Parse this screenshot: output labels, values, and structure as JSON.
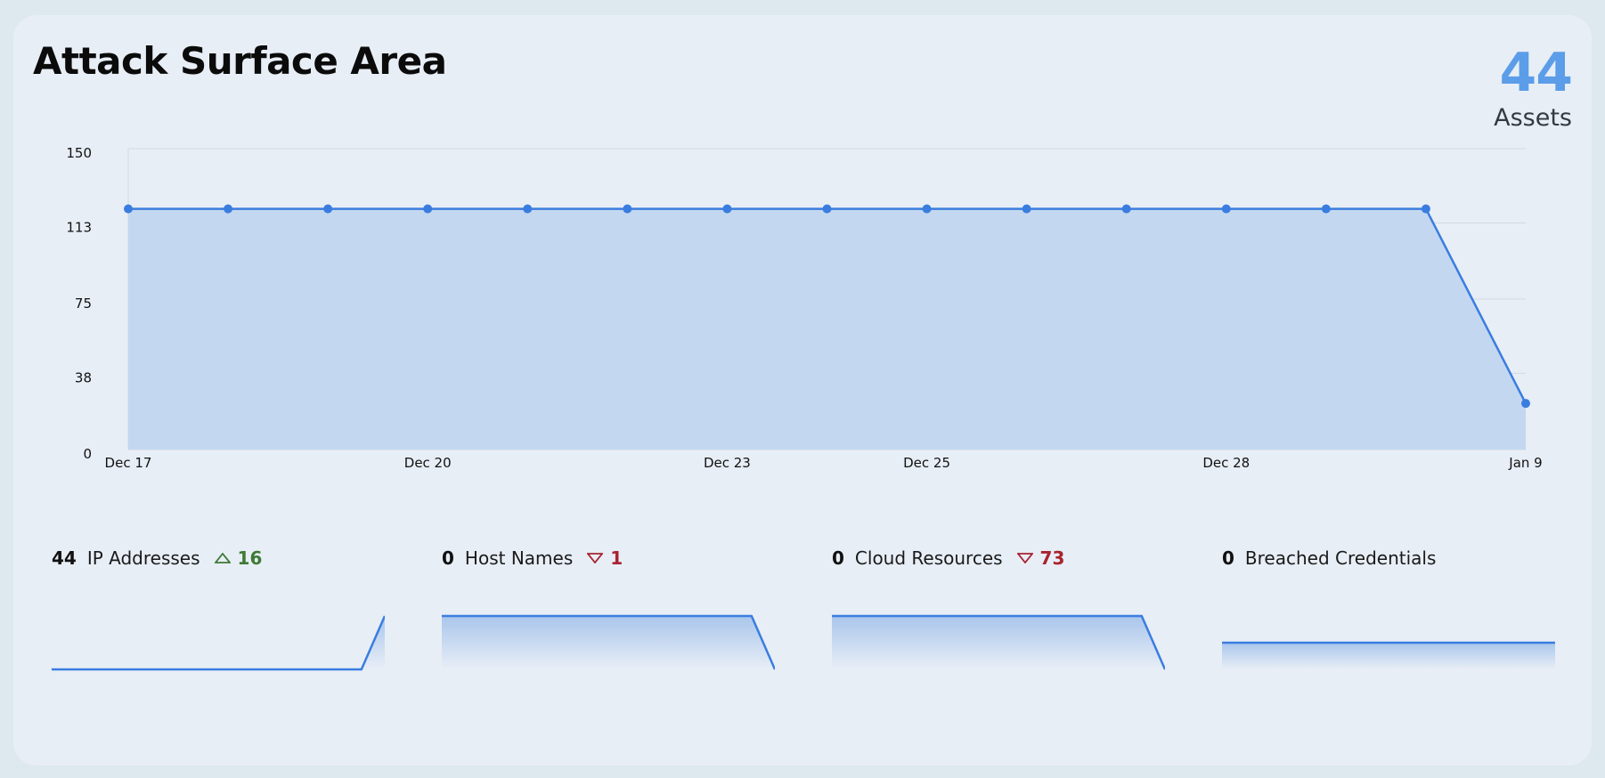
{
  "header": {
    "title": "Attack Surface Area",
    "total_value": "44",
    "total_label": "Assets"
  },
  "colors": {
    "accent": "#3a7de0",
    "fill": "#c3d7f0",
    "total": "#5b9de8",
    "up": "#3d7a35",
    "down": "#a8232f"
  },
  "chart_data": {
    "type": "area",
    "x": [
      "Dec 17",
      "Dec 18",
      "Dec 19",
      "Dec 20",
      "Dec 21",
      "Dec 22",
      "Dec 23",
      "Dec 24",
      "Dec 25",
      "Dec 26",
      "Dec 27",
      "Dec 28",
      "Dec 29",
      "Dec 30",
      "Jan 9"
    ],
    "values": [
      120,
      120,
      120,
      120,
      120,
      120,
      120,
      120,
      120,
      120,
      120,
      120,
      120,
      120,
      23
    ],
    "xticks": [
      "Dec 17",
      "Dec 20",
      "Dec 23",
      "Dec 25",
      "Dec 28",
      "Jan 9"
    ],
    "yticks": [
      "150",
      "113",
      "75",
      "38",
      "0"
    ],
    "ylim": [
      0,
      150
    ],
    "grid": true,
    "markers": true
  },
  "stats": [
    {
      "count": "44",
      "label": "IP Addresses",
      "trend": "up",
      "delta": "16",
      "spark": [
        0,
        0,
        0,
        0,
        0,
        0,
        0,
        0,
        0,
        0,
        0,
        0,
        1
      ]
    },
    {
      "count": "0",
      "label": "Host Names",
      "trend": "down",
      "delta": "1",
      "spark": [
        1,
        1,
        1,
        1,
        1,
        1,
        1,
        1,
        1,
        1,
        1,
        1,
        0
      ]
    },
    {
      "count": "0",
      "label": "Cloud Resources",
      "trend": "down",
      "delta": "73",
      "spark": [
        1,
        1,
        1,
        1,
        1,
        1,
        1,
        1,
        1,
        1,
        1,
        1,
        0
      ]
    },
    {
      "count": "0",
      "label": "Breached Credentials",
      "trend": "none",
      "delta": "",
      "spark": [
        0.5,
        0.5,
        0.5,
        0.5,
        0.5,
        0.5,
        0.5,
        0.5,
        0.5,
        0.5,
        0.5,
        0.5,
        0.5
      ]
    }
  ]
}
